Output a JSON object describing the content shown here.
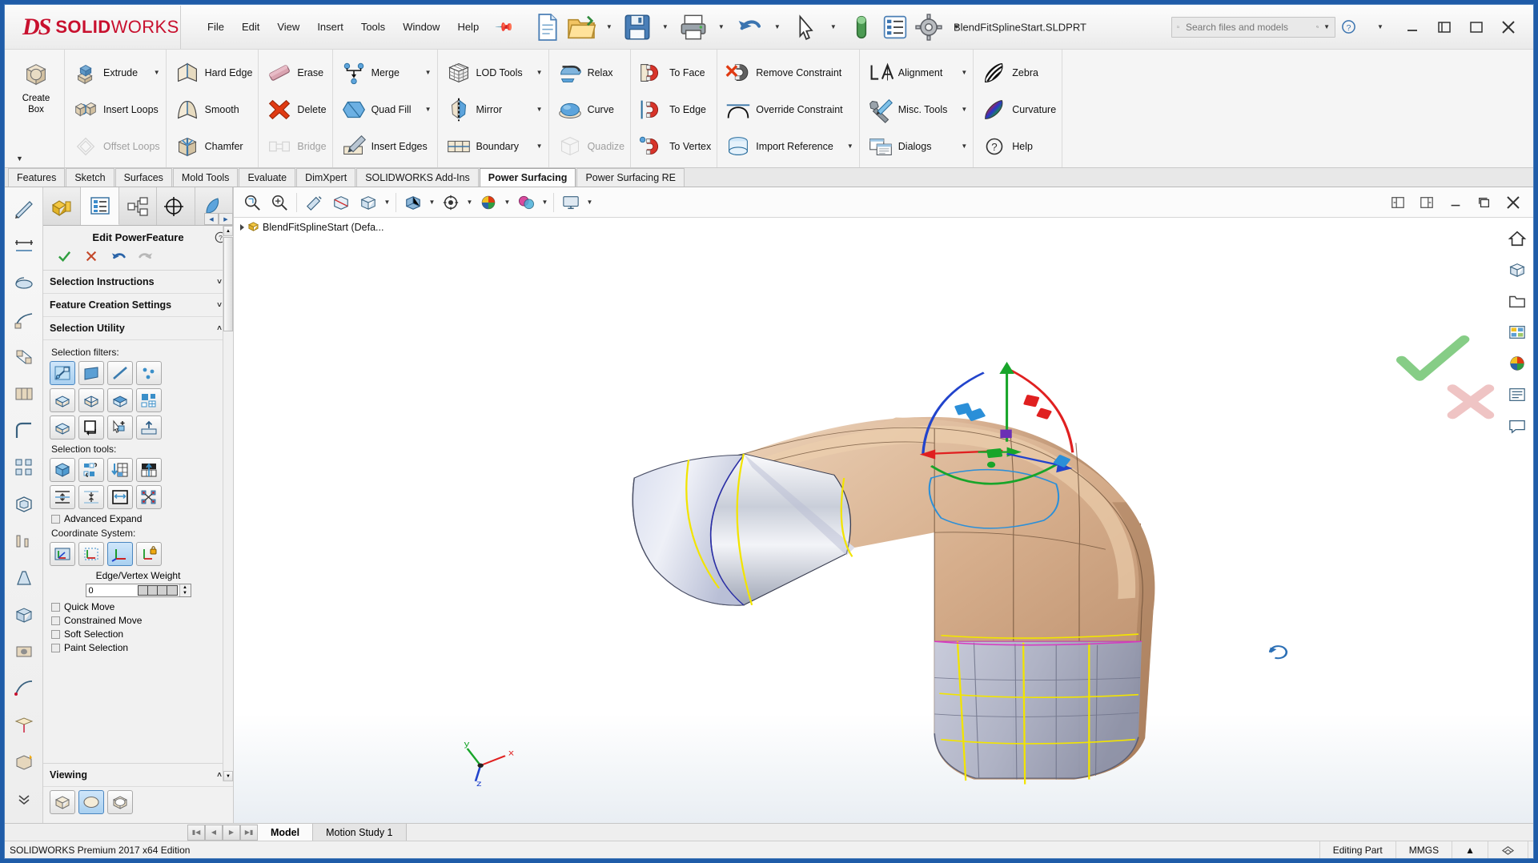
{
  "window": {
    "document_title": "BlendFitSplineStart.SLDPRT",
    "brand_ds": "DS",
    "brand_solid": "SOLID",
    "brand_works": "WORKS"
  },
  "menu": {
    "items": [
      "File",
      "Edit",
      "View",
      "Insert",
      "Tools",
      "Window",
      "Help"
    ]
  },
  "search": {
    "placeholder": "Search files and models"
  },
  "ribbon": {
    "groups": [
      {
        "name": "create",
        "big": [
          {
            "label": "Create\nBox",
            "label_line1": "Create",
            "label_line2": "Box",
            "icon": "create-box-icon"
          }
        ]
      },
      {
        "name": "edit",
        "items": [
          {
            "label": "Extrude",
            "icon": "extrude-icon",
            "dropdown": true,
            "disabled": false
          },
          {
            "label": "Insert Loops",
            "icon": "insert-loops-icon",
            "dropdown": false,
            "disabled": false
          },
          {
            "label": "Offset Loops",
            "icon": "offset-loops-icon",
            "dropdown": false,
            "disabled": true
          }
        ]
      },
      {
        "name": "edge",
        "items": [
          {
            "label": "Hard Edge",
            "icon": "hard-edge-icon",
            "dropdown": false,
            "disabled": false
          },
          {
            "label": "Smooth",
            "icon": "smooth-icon",
            "dropdown": false,
            "disabled": false
          },
          {
            "label": "Chamfer",
            "icon": "chamfer-icon",
            "dropdown": false,
            "disabled": false
          }
        ]
      },
      {
        "name": "delete",
        "items": [
          {
            "label": "Erase",
            "icon": "erase-icon",
            "dropdown": false,
            "disabled": false
          },
          {
            "label": "Delete",
            "icon": "delete-icon",
            "dropdown": false,
            "disabled": false
          },
          {
            "label": "Bridge",
            "icon": "bridge-icon",
            "dropdown": false,
            "disabled": true
          }
        ]
      },
      {
        "name": "merge",
        "items": [
          {
            "label": "Merge",
            "icon": "merge-icon",
            "dropdown": true,
            "disabled": false
          },
          {
            "label": "Quad Fill",
            "icon": "quad-fill-icon",
            "dropdown": true,
            "disabled": false
          },
          {
            "label": "Insert Edges",
            "icon": "insert-edges-icon",
            "dropdown": false,
            "disabled": false
          }
        ]
      },
      {
        "name": "tools",
        "items": [
          {
            "label": "LOD Tools",
            "icon": "lod-tools-icon",
            "dropdown": true,
            "disabled": false
          },
          {
            "label": "Mirror",
            "icon": "mirror-icon",
            "dropdown": true,
            "disabled": false
          },
          {
            "label": "Boundary",
            "icon": "boundary-icon",
            "dropdown": true,
            "disabled": false
          }
        ]
      },
      {
        "name": "relax",
        "items": [
          {
            "label": "Relax",
            "icon": "relax-icon",
            "dropdown": false,
            "disabled": false
          },
          {
            "label": "Curve",
            "icon": "curve-icon",
            "dropdown": false,
            "disabled": false
          },
          {
            "label": "Quadize",
            "icon": "quadize-icon",
            "dropdown": false,
            "disabled": true
          }
        ]
      },
      {
        "name": "constrain-to",
        "items": [
          {
            "label": "To Face",
            "icon": "to-face-magnet-icon",
            "dropdown": false,
            "disabled": false
          },
          {
            "label": "To Edge",
            "icon": "to-edge-magnet-icon",
            "dropdown": false,
            "disabled": false
          },
          {
            "label": "To Vertex",
            "icon": "to-vertex-magnet-icon",
            "dropdown": false,
            "disabled": false
          }
        ]
      },
      {
        "name": "constraints",
        "items": [
          {
            "label": "Remove Constraint",
            "icon": "remove-constraint-icon",
            "dropdown": false,
            "disabled": false
          },
          {
            "label": "Override Constraint",
            "icon": "override-constraint-icon",
            "dropdown": false,
            "disabled": false
          },
          {
            "label": "Import Reference",
            "icon": "import-reference-icon",
            "dropdown": true,
            "disabled": false
          }
        ]
      },
      {
        "name": "misc",
        "items": [
          {
            "label": "Alignment",
            "icon": "alignment-icon",
            "dropdown": true,
            "disabled": false
          },
          {
            "label": "Misc. Tools",
            "icon": "misc-tools-icon",
            "dropdown": true,
            "disabled": false
          },
          {
            "label": "Dialogs",
            "icon": "dialogs-icon",
            "dropdown": true,
            "disabled": false
          }
        ]
      },
      {
        "name": "analysis",
        "items": [
          {
            "label": "Zebra",
            "icon": "zebra-icon",
            "dropdown": false,
            "disabled": false
          },
          {
            "label": "Curvature",
            "icon": "curvature-icon",
            "dropdown": false,
            "disabled": false
          },
          {
            "label": "Help",
            "icon": "help-circle-icon",
            "dropdown": false,
            "disabled": false
          }
        ]
      }
    ]
  },
  "command_tabs": {
    "items": [
      "Features",
      "Sketch",
      "Surfaces",
      "Mold Tools",
      "Evaluate",
      "DimXpert",
      "SOLIDWORKS Add-Ins",
      "Power Surfacing",
      "Power Surfacing RE"
    ],
    "active": "Power Surfacing"
  },
  "property_manager": {
    "title": "Edit PowerFeature",
    "tabs": [
      "feature-manager-tab",
      "property-manager-tab",
      "configuration-manager-tab",
      "dimxpert-manager-tab",
      "display-manager-tab"
    ],
    "active_tab_index": 1,
    "actions": [
      "ok-check",
      "cancel-x",
      "undo",
      "redo"
    ],
    "sections": [
      {
        "label": "Selection Instructions",
        "expanded": false
      },
      {
        "label": "Feature Creation Settings",
        "expanded": false
      },
      {
        "label": "Selection Utility",
        "expanded": true
      },
      {
        "label": "Viewing",
        "expanded": true
      }
    ],
    "selection_filters_label": "Selection filters:",
    "selection_filters": [
      {
        "name": "filter-all",
        "selected": true
      },
      {
        "name": "filter-face",
        "selected": false
      },
      {
        "name": "filter-edge",
        "selected": false
      },
      {
        "name": "filter-vertex",
        "selected": false
      },
      {
        "name": "filter-loop-horizontal",
        "selected": false
      },
      {
        "name": "filter-loop-vertical",
        "selected": false
      },
      {
        "name": "filter-loop-full",
        "selected": false
      },
      {
        "name": "filter-quad-pattern",
        "selected": false
      },
      {
        "name": "filter-region",
        "selected": false
      },
      {
        "name": "filter-boundary",
        "selected": false
      },
      {
        "name": "filter-add-selection",
        "selected": false
      },
      {
        "name": "filter-extend-selection",
        "selected": false
      }
    ],
    "selection_tools_label": "Selection tools:",
    "selection_tools": [
      {
        "name": "tool-select-box",
        "selected": false
      },
      {
        "name": "tool-invert-selection",
        "selected": false
      },
      {
        "name": "tool-shrink-selection",
        "selected": false
      },
      {
        "name": "tool-grow-selection",
        "selected": false
      },
      {
        "name": "tool-expand-vertical",
        "selected": false
      },
      {
        "name": "tool-contract-vertical",
        "selected": false
      },
      {
        "name": "tool-expand-horizontal",
        "selected": false
      },
      {
        "name": "tool-scatter-selection",
        "selected": false
      }
    ],
    "advanced_expand": {
      "label": "Advanced Expand",
      "checked": false
    },
    "coordinate_system_label": "Coordinate System:",
    "coordinate_system": [
      {
        "name": "cs-screen",
        "selected": false
      },
      {
        "name": "cs-local",
        "selected": false
      },
      {
        "name": "cs-world",
        "selected": true
      },
      {
        "name": "cs-locked",
        "selected": false
      }
    ],
    "edge_vertex_weight": {
      "label": "Edge/Vertex Weight",
      "value": "0"
    },
    "checkboxes": [
      {
        "label": "Quick Move",
        "checked": false
      },
      {
        "label": "Constrained Move",
        "checked": false
      },
      {
        "label": "Soft Selection",
        "checked": false
      },
      {
        "label": "Paint Selection",
        "checked": false
      }
    ],
    "viewing_label": "Viewing",
    "viewing_modes": [
      {
        "name": "view-control-cage",
        "selected": false
      },
      {
        "name": "view-smooth-surface",
        "selected": true
      },
      {
        "name": "view-cage-and-surface",
        "selected": false
      }
    ]
  },
  "graphics": {
    "feature_tree_item": "BlendFitSplineStart  (Defa...",
    "toolbar_items": [
      "zoom-to-fit-icon",
      "zoom-area-icon",
      "previous-view-icon",
      "section-view-icon",
      "view-orientation-icon",
      "display-style-icon",
      "hide-show-icon",
      "edit-appearance-icon",
      "apply-scene-icon",
      "view-settings-icon"
    ],
    "view_rail_items": [
      "home-view-icon",
      "view-orientation-cube-icon",
      "folder-open-icon",
      "display-pane-icon",
      "appearance-sphere-icon",
      "scene-list-icon",
      "annotations-icon"
    ],
    "window_controls": [
      "restore-left-icon",
      "restore-right-icon",
      "minimize-icon",
      "maximize-icon",
      "close-icon"
    ],
    "confirm_corner": [
      "confirm-check-icon",
      "cancel-cross-icon"
    ]
  },
  "bottom_tabs": {
    "items": [
      "Model",
      "Motion Study 1"
    ],
    "active": "Model"
  },
  "status_bar": {
    "left": "SOLIDWORKS Premium 2017 x64 Edition",
    "editing": "Editing Part",
    "units": "MMGS"
  },
  "colors": {
    "brand_red": "#c8102e",
    "accent_blue": "#2a5f9e",
    "model_tan": "#c9a286",
    "model_blue_grey": "#c3c7dd",
    "highlight": "#dbeaf8"
  }
}
